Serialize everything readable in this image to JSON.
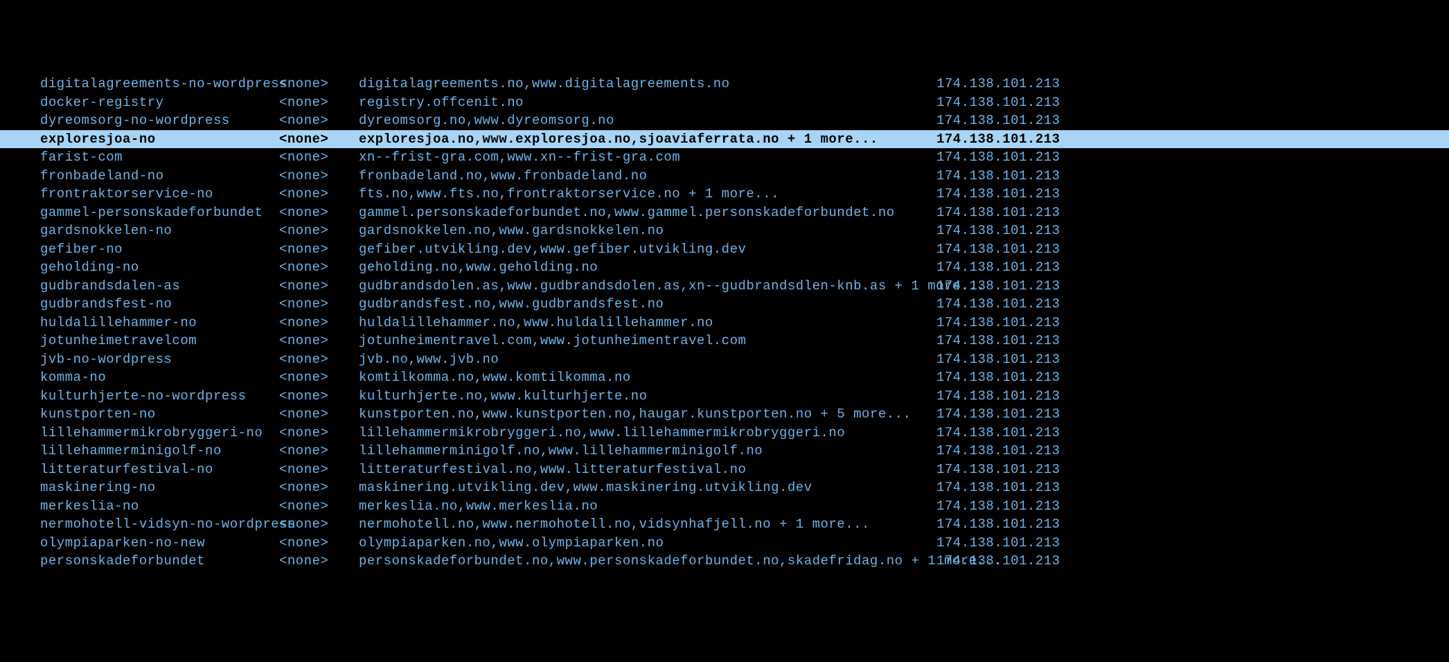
{
  "rows": [
    {
      "name": "digitalagreements-no-wordpress",
      "type": "<none>",
      "domains": "digitalagreements.no,www.digitalagreements.no",
      "ip": "174.138.101.213",
      "selected": false
    },
    {
      "name": "docker-registry",
      "type": "<none>",
      "domains": "registry.offcenit.no",
      "ip": "174.138.101.213",
      "selected": false
    },
    {
      "name": "dyreomsorg-no-wordpress",
      "type": "<none>",
      "domains": "dyreomsorg.no,www.dyreomsorg.no",
      "ip": "174.138.101.213",
      "selected": false
    },
    {
      "name": "exploresjoa-no",
      "type": "<none>",
      "domains": "exploresjoa.no,www.exploresjoa.no,sjoaviaferrata.no + 1 more...",
      "ip": "174.138.101.213",
      "selected": true
    },
    {
      "name": "farist-com",
      "type": "<none>",
      "domains": "xn--frist-gra.com,www.xn--frist-gra.com",
      "ip": "174.138.101.213",
      "selected": false
    },
    {
      "name": "fronbadeland-no",
      "type": "<none>",
      "domains": "fronbadeland.no,www.fronbadeland.no",
      "ip": "174.138.101.213",
      "selected": false
    },
    {
      "name": "frontraktorservice-no",
      "type": "<none>",
      "domains": "fts.no,www.fts.no,frontraktorservice.no + 1 more...",
      "ip": "174.138.101.213",
      "selected": false
    },
    {
      "name": "gammel-personskadeforbundet",
      "type": "<none>",
      "domains": "gammel.personskadeforbundet.no,www.gammel.personskadeforbundet.no",
      "ip": "174.138.101.213",
      "selected": false
    },
    {
      "name": "gardsnokkelen-no",
      "type": "<none>",
      "domains": "gardsnokkelen.no,www.gardsnokkelen.no",
      "ip": "174.138.101.213",
      "selected": false
    },
    {
      "name": "gefiber-no",
      "type": "<none>",
      "domains": "gefiber.utvikling.dev,www.gefiber.utvikling.dev",
      "ip": "174.138.101.213",
      "selected": false
    },
    {
      "name": "geholding-no",
      "type": "<none>",
      "domains": "geholding.no,www.geholding.no",
      "ip": "174.138.101.213",
      "selected": false
    },
    {
      "name": "gudbrandsdalen-as",
      "type": "<none>",
      "domains": "gudbrandsdolen.as,www.gudbrandsdolen.as,xn--gudbrandsdlen-knb.as + 1 more...",
      "ip": "174.138.101.213",
      "selected": false
    },
    {
      "name": "gudbrandsfest-no",
      "type": "<none>",
      "domains": "gudbrandsfest.no,www.gudbrandsfest.no",
      "ip": "174.138.101.213",
      "selected": false
    },
    {
      "name": "huldalillehammer-no",
      "type": "<none>",
      "domains": "huldalillehammer.no,www.huldalillehammer.no",
      "ip": "174.138.101.213",
      "selected": false
    },
    {
      "name": "jotunheimetravelcom",
      "type": "<none>",
      "domains": "jotunheimentravel.com,www.jotunheimentravel.com",
      "ip": "174.138.101.213",
      "selected": false
    },
    {
      "name": "jvb-no-wordpress",
      "type": "<none>",
      "domains": "jvb.no,www.jvb.no",
      "ip": "174.138.101.213",
      "selected": false
    },
    {
      "name": "komma-no",
      "type": "<none>",
      "domains": "komtilkomma.no,www.komtilkomma.no",
      "ip": "174.138.101.213",
      "selected": false
    },
    {
      "name": "kulturhjerte-no-wordpress",
      "type": "<none>",
      "domains": "kulturhjerte.no,www.kulturhjerte.no",
      "ip": "174.138.101.213",
      "selected": false
    },
    {
      "name": "kunstporten-no",
      "type": "<none>",
      "domains": "kunstporten.no,www.kunstporten.no,haugar.kunstporten.no + 5 more...",
      "ip": "174.138.101.213",
      "selected": false
    },
    {
      "name": "lillehammermikrobryggeri-no",
      "type": "<none>",
      "domains": "lillehammermikrobryggeri.no,www.lillehammermikrobryggeri.no",
      "ip": "174.138.101.213",
      "selected": false
    },
    {
      "name": "lillehammerminigolf-no",
      "type": "<none>",
      "domains": "lillehammerminigolf.no,www.lillehammerminigolf.no",
      "ip": "174.138.101.213",
      "selected": false
    },
    {
      "name": "litteraturfestival-no",
      "type": "<none>",
      "domains": "litteraturfestival.no,www.litteraturfestival.no",
      "ip": "174.138.101.213",
      "selected": false
    },
    {
      "name": "maskinering-no",
      "type": "<none>",
      "domains": "maskinering.utvikling.dev,www.maskinering.utvikling.dev",
      "ip": "174.138.101.213",
      "selected": false
    },
    {
      "name": "merkeslia-no",
      "type": "<none>",
      "domains": "merkeslia.no,www.merkeslia.no",
      "ip": "174.138.101.213",
      "selected": false
    },
    {
      "name": "nermohotell-vidsyn-no-wordpress",
      "type": "<none>",
      "domains": "nermohotell.no,www.nermohotell.no,vidsynhafjell.no + 1 more...",
      "ip": "174.138.101.213",
      "selected": false
    },
    {
      "name": "olympiaparken-no-new",
      "type": "<none>",
      "domains": "olympiaparken.no,www.olympiaparken.no",
      "ip": "174.138.101.213",
      "selected": false
    },
    {
      "name": "personskadeforbundet",
      "type": "<none>",
      "domains": "personskadeforbundet.no,www.personskadeforbundet.no,skadefridag.no + 1 more...",
      "ip": "174.138.101.213",
      "selected": false
    }
  ]
}
